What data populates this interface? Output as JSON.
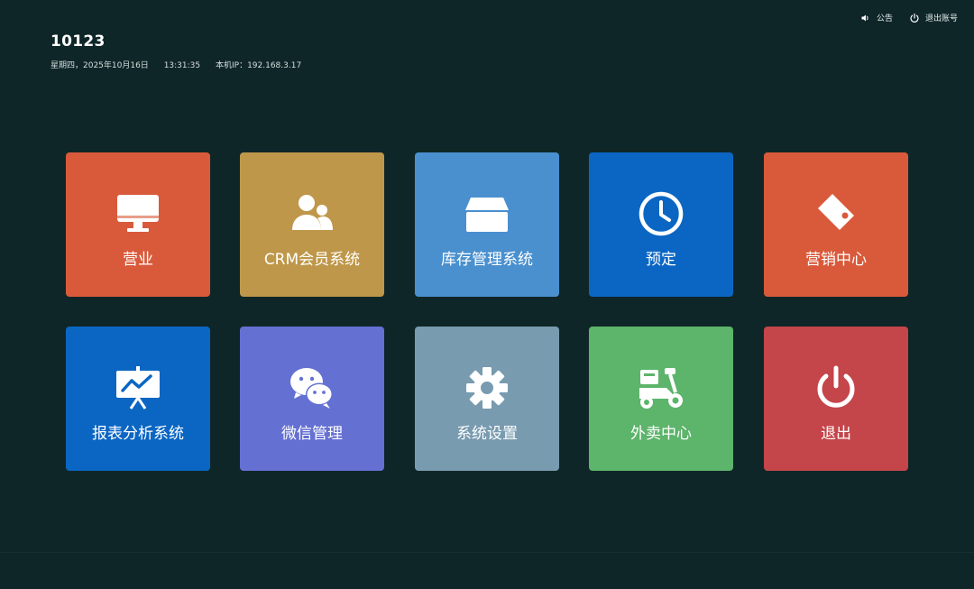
{
  "header": {
    "store_id": "10123",
    "weekday_date": "星期四，2025年10月16日",
    "time": "13:31:35",
    "ip_text": "本机IP：192.168.3.17"
  },
  "top_actions": {
    "announcement_label": "公告",
    "logout_account_label": "退出账号"
  },
  "tiles": [
    {
      "label": "营业",
      "color": "#d95a3b",
      "icon": "monitor-icon"
    },
    {
      "label": "CRM会员系统",
      "color": "#bf974a",
      "icon": "users-icon"
    },
    {
      "label": "库存管理系统",
      "color": "#4a90cf",
      "icon": "box-icon"
    },
    {
      "label": "预定",
      "color": "#0b66c3",
      "icon": "clock-icon"
    },
    {
      "label": "营销中心",
      "color": "#d95a3b",
      "icon": "tag-icon"
    },
    {
      "label": "报表分析系统",
      "color": "#0b66c3",
      "icon": "chart-board-icon"
    },
    {
      "label": "微信管理",
      "color": "#6470d2",
      "icon": "wechat-icon"
    },
    {
      "label": "系统设置",
      "color": "#789bb0",
      "icon": "gear-icon"
    },
    {
      "label": "外卖中心",
      "color": "#5db46b",
      "icon": "scooter-icon"
    },
    {
      "label": "退出",
      "color": "#c4454a",
      "icon": "power-icon"
    }
  ]
}
